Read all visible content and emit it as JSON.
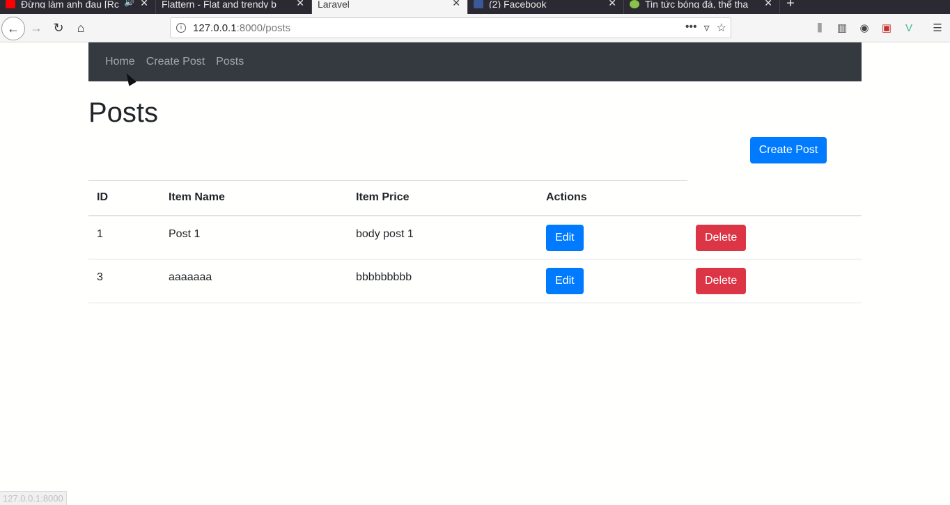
{
  "browser": {
    "tabs": [
      {
        "title": "Đừng làm anh đau [Rc",
        "icon": "youtube-icon",
        "color": "#ff0000",
        "sound": true
      },
      {
        "title": "Flattern - Flat and trendy b",
        "icon": "",
        "color": "",
        "sound": false
      },
      {
        "title": "Laravel",
        "icon": "",
        "color": "",
        "sound": false,
        "active": true
      },
      {
        "title": "(2) Facebook",
        "icon": "facebook-icon",
        "color": "#3b5998",
        "sound": false
      },
      {
        "title": "Tin tức bóng đá, thể tha",
        "icon": "site-icon",
        "color": "#8bc34a",
        "sound": false
      }
    ],
    "url_host": "127.0.0.1",
    "url_path": ":8000/posts",
    "status_text": "127.0.0.1:8000"
  },
  "page": {
    "nav": {
      "home": "Home",
      "create_post": "Create Post",
      "posts": "Posts"
    },
    "title": "Posts",
    "create_button": "Create Post",
    "table": {
      "headers": [
        "ID",
        "Item Name",
        "Item Price",
        "Actions"
      ],
      "rows": [
        {
          "id": "1",
          "name": "Post 1",
          "price": "body post 1",
          "edit": "Edit",
          "delete": "Delete"
        },
        {
          "id": "3",
          "name": "aaaaaaa",
          "price": "bbbbbbbbb",
          "edit": "Edit",
          "delete": "Delete"
        }
      ]
    }
  },
  "colors": {
    "primary": "#007bff",
    "danger": "#dc3545",
    "navbar": "#343a40"
  }
}
